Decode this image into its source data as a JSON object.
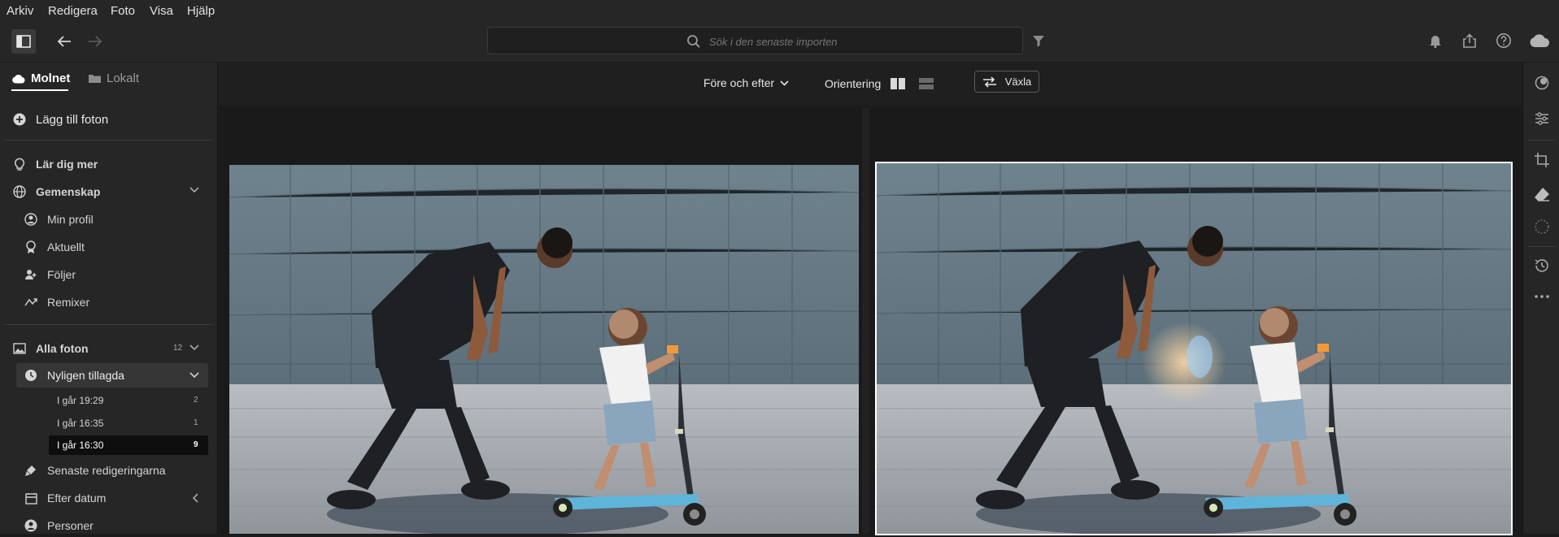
{
  "menubar": {
    "items": [
      "Arkiv",
      "Redigera",
      "Foto",
      "Visa",
      "Hjälp"
    ]
  },
  "toolbar": {
    "search_placeholder": "Sök i den senaste importen"
  },
  "sidebar": {
    "tabs": {
      "cloud": "Molnet",
      "local": "Lokalt"
    },
    "add_photos": "Lägg till foton",
    "learn_more": "Lär dig mer",
    "community": "Gemenskap",
    "my_profile": "Min profil",
    "current": "Aktuellt",
    "following": "Följer",
    "remixes": "Remixer",
    "all_photos": {
      "label": "Alla foton",
      "count": "12"
    },
    "recently_added": "Nyligen tillagda",
    "imports": [
      {
        "label": "I går 19:29",
        "count": "2"
      },
      {
        "label": "I går 16:35",
        "count": "1"
      },
      {
        "label": "I går 16:30",
        "count": "9"
      }
    ],
    "recent_edits": "Senaste redigeringarna",
    "by_date": "Efter datum",
    "people": "Personer"
  },
  "compare": {
    "mode": "Före och efter",
    "orientation": "Orientering",
    "swap": "Växla"
  },
  "colors": {
    "accent": "#ffffff",
    "background": "#1b1b1b",
    "panel": "#262626"
  }
}
